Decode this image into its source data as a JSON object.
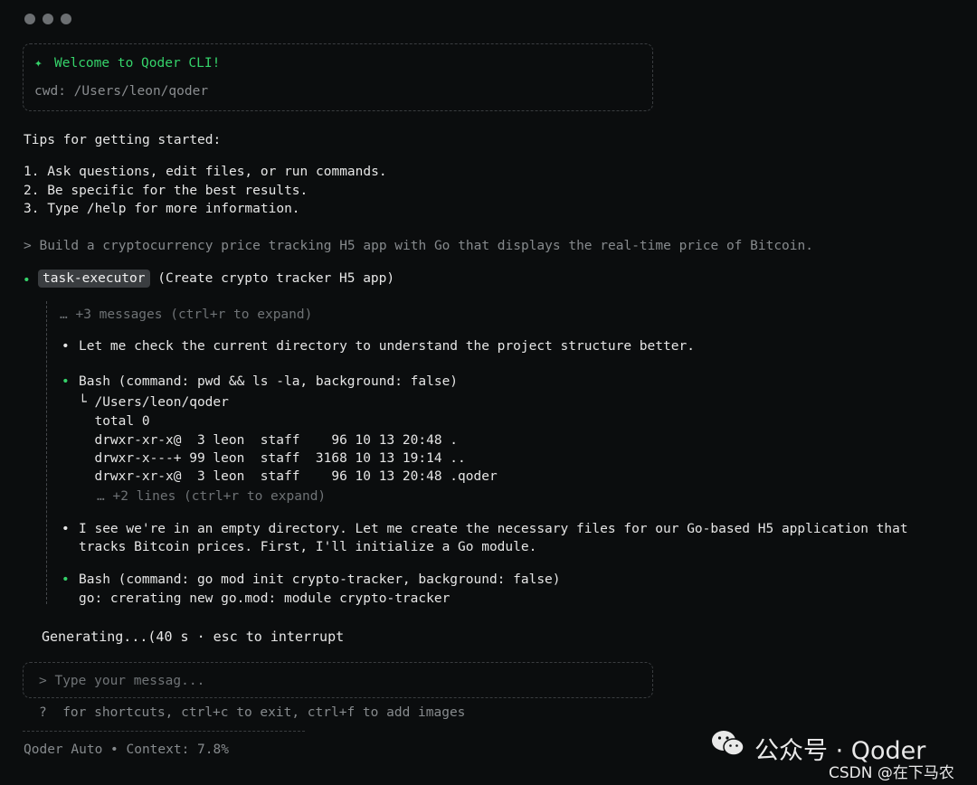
{
  "header": {
    "welcome": "Welcome to Qoder CLI!",
    "cwd": "cwd: /Users/leon/qoder"
  },
  "tips": {
    "title": "Tips for getting started:",
    "items": [
      "1. Ask questions, edit files, or run commands.",
      "2. Be specific for the best results.",
      "3. Type /help for more information."
    ]
  },
  "prompt": "> Build a cryptocurrency price tracking H5 app with Go that displays the real-time price of Bitcoin.",
  "task": {
    "name": "task-executor",
    "desc": "(Create crypto tracker H5 app)",
    "collapsed": "… +3 messages (ctrl+r to expand)",
    "message1": "Let me check the current directory to understand the project structure better.",
    "bash1": {
      "command": "Bash (command: pwd && ls -la, background: false)",
      "output": [
        "└ /Users/leon/qoder",
        "  total 0",
        "  drwxr-xr-x@  3 leon  staff    96 10 13 20:48 .",
        "  drwxr-x---+ 99 leon  staff  3168 10 13 19:14 ..",
        "  drwxr-xr-x@  3 leon  staff    96 10 13 20:48 .qoder"
      ],
      "more": "… +2 lines (ctrl+r to expand)"
    },
    "message2": [
      "I see we're in an empty directory. Let me create the necessary files for our Go-based H5 application that",
      "tracks Bitcoin prices. First, I'll initialize a Go module."
    ],
    "bash2": {
      "command": "Bash (command: go mod init crypto-tracker, background: false)",
      "output": "go: crerating new go.mod: module crypto-tracker"
    }
  },
  "status": "Generating...(40 s · esc to interrupt",
  "input": {
    "placeholder": "> Type your messag..."
  },
  "hints": "?  for shortcuts, ctrl+c to exit, ctrl+f to add images",
  "footer": "Qoder Auto • Context: 7.8%",
  "watermark": {
    "line1": "公众号 · Qoder",
    "line2": "CSDN @在下马农"
  },
  "colors": {
    "accent": "#35d36a",
    "background": "#0b0d0e"
  }
}
